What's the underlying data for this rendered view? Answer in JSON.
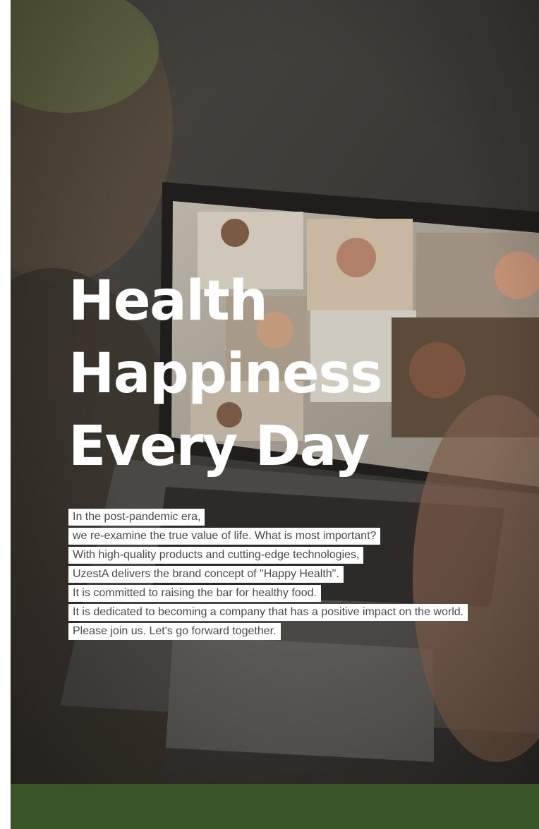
{
  "hero": {
    "headline": [
      "Health",
      "Happiness",
      "Every Day"
    ],
    "intro_lines": [
      "In the post-pandemic era,",
      "we re-examine the true value of life. What is most important?",
      "With high-quality products and cutting-edge technologies,",
      "UzestA delivers the brand concept of \"Happy Health\".",
      "It is committed to raising the bar for healthy food.",
      "It is dedicated to becoming a company that has a positive impact on the world.",
      "Please join us. Let's go forward together."
    ]
  },
  "colors": {
    "headline_text": "#ffffff",
    "intro_text": "#4a4a4a",
    "intro_background": "#ffffff",
    "footer_band": "#3a5427"
  }
}
